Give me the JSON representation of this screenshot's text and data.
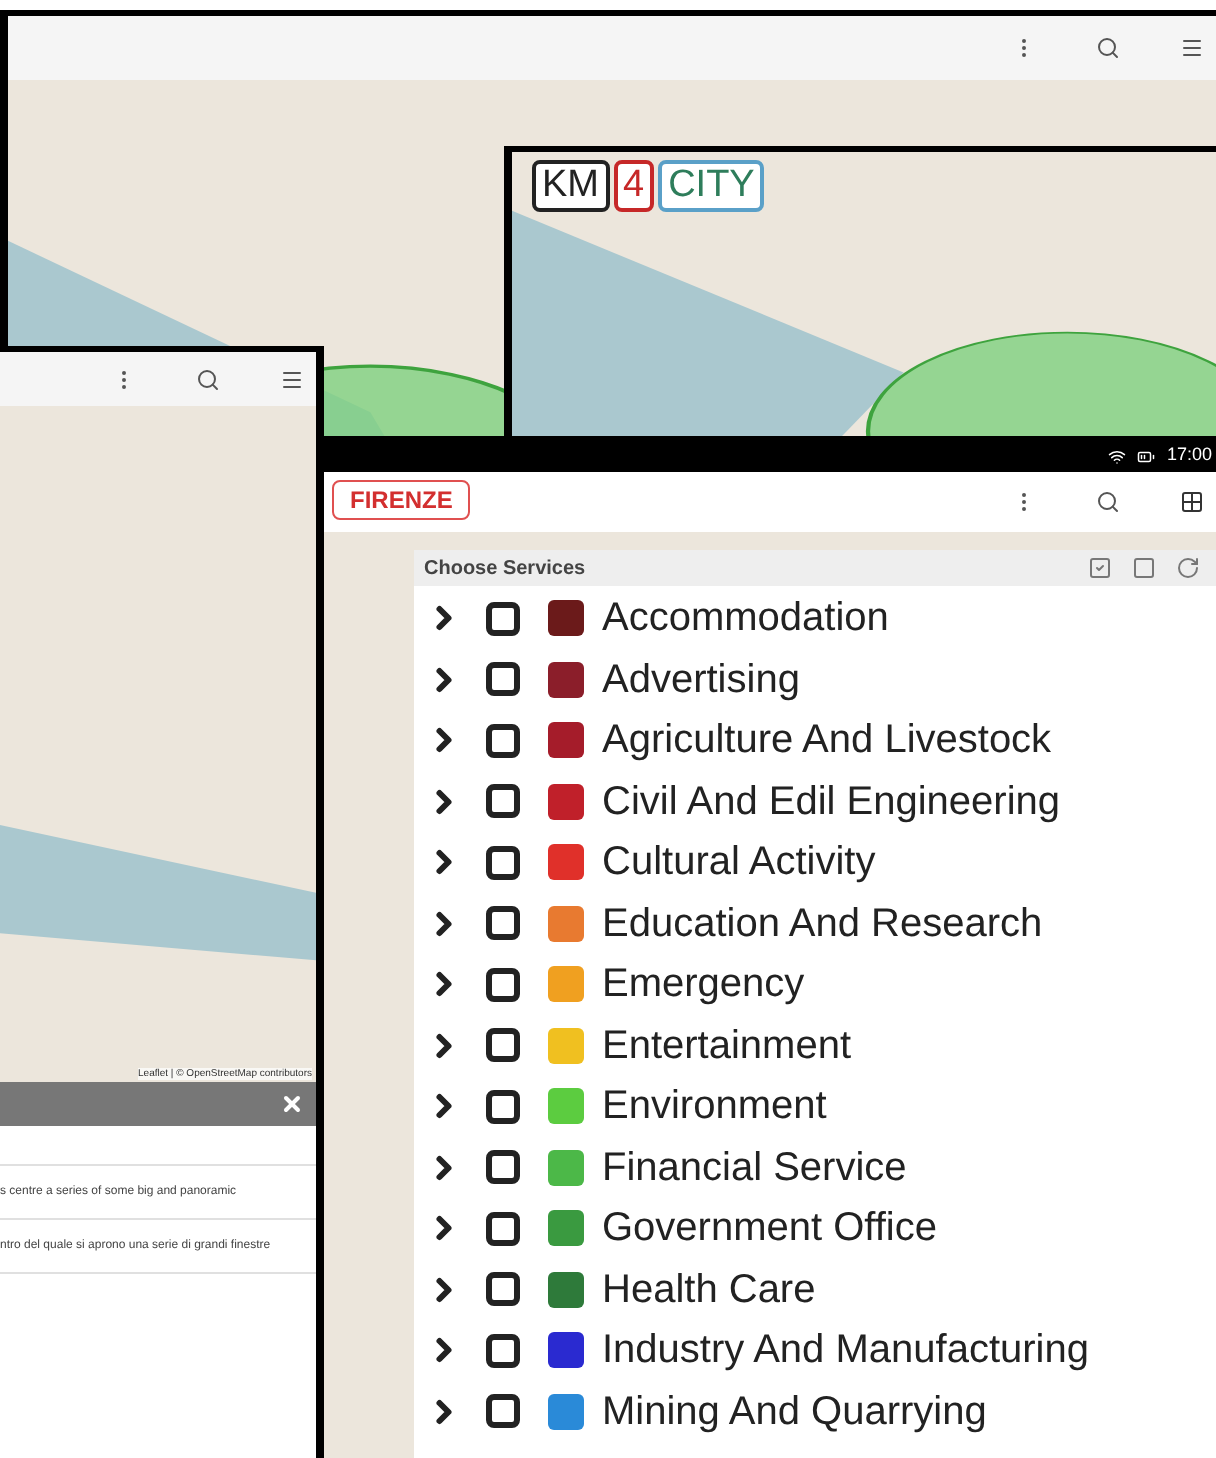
{
  "km4city_screen": {
    "logo_parts": [
      "KM",
      "4",
      "CITY"
    ]
  },
  "left_screen": {
    "map_attribution": "Leaflet | © OpenStreetMap contributors",
    "description_rows": [
      "s centre a series of some big and panoramic",
      "ntro del quale si aprono una serie di grandi finestre"
    ]
  },
  "tablet_screen": {
    "status_bar": {
      "time": "17:00"
    },
    "logo": "FIRENZE",
    "panel": {
      "title": "Choose Services",
      "services": [
        {
          "name": "Accommodation",
          "color": "#6b1a1a",
          "checked": false
        },
        {
          "name": "Advertising",
          "color": "#8b1e2a",
          "checked": false
        },
        {
          "name": "Agriculture And Livestock",
          "color": "#a51c2a",
          "checked": false
        },
        {
          "name": "Civil And Edil Engineering",
          "color": "#c0202a",
          "checked": false
        },
        {
          "name": "Cultural Activity",
          "color": "#e0302a",
          "checked": false
        },
        {
          "name": "Education And Research",
          "color": "#e87a30",
          "checked": false
        },
        {
          "name": "Emergency",
          "color": "#f0a020",
          "checked": false
        },
        {
          "name": "Entertainment",
          "color": "#f0c020",
          "checked": false
        },
        {
          "name": "Environment",
          "color": "#5ccc40",
          "checked": false
        },
        {
          "name": "Financial Service",
          "color": "#4cb848",
          "checked": false
        },
        {
          "name": "Government Office",
          "color": "#3a9a40",
          "checked": false
        },
        {
          "name": "Health Care",
          "color": "#2e7a3a",
          "checked": false
        },
        {
          "name": "Industry And Manufacturing",
          "color": "#2a2ad0",
          "checked": false
        },
        {
          "name": "Mining And Quarrying",
          "color": "#2a8ad8",
          "checked": false
        }
      ]
    }
  }
}
